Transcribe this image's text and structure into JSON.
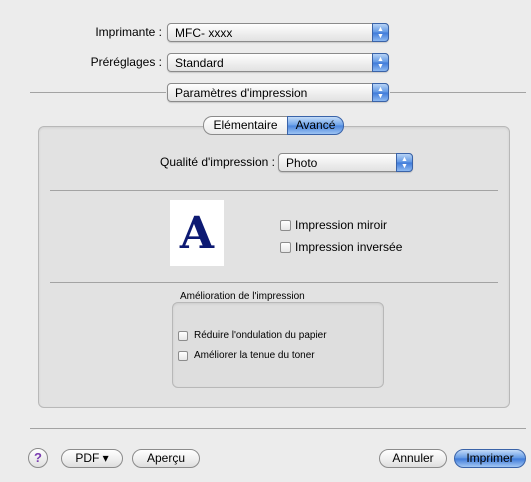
{
  "printer": {
    "label": "Imprimante :",
    "value": "MFC- xxxx"
  },
  "presets": {
    "label": "Préréglages :",
    "value": "Standard"
  },
  "panel": {
    "value": "Paramètres d'impression"
  },
  "tabs": [
    {
      "label": "Elémentaire",
      "selected": false
    },
    {
      "label": "Avancé",
      "selected": true
    }
  ],
  "quality": {
    "label": "Qualité d'impression :",
    "value": "Photo"
  },
  "preview": {
    "glyph": "A"
  },
  "options": [
    {
      "label": "Impression miroir",
      "checked": false
    },
    {
      "label": "Impression inversée",
      "checked": false
    }
  ],
  "enhancement": {
    "title": "Amélioration de l'impression",
    "items": [
      {
        "label": "Réduire l'ondulation du papier",
        "checked": false
      },
      {
        "label": "Améliorer la tenue du toner",
        "checked": false
      }
    ]
  },
  "footer": {
    "help": "?",
    "pdf": "PDF ▾",
    "preview": "Aperçu",
    "cancel": "Annuler",
    "print": "Imprimer"
  },
  "colors": {
    "accent": "#5d95e3",
    "glyph": "#0d1a73"
  }
}
